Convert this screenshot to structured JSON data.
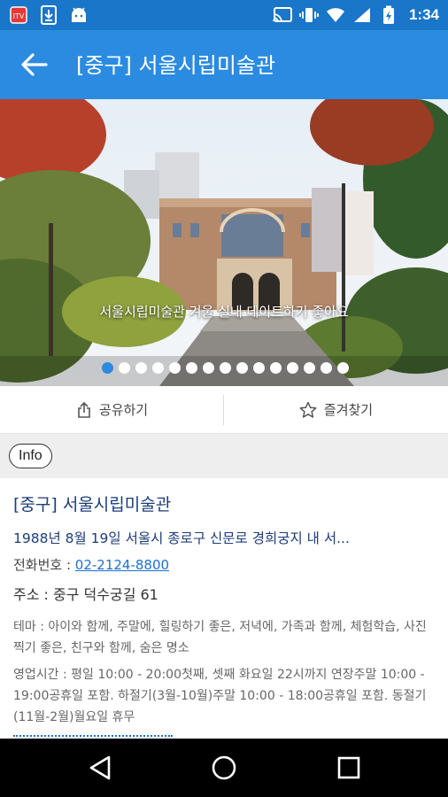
{
  "status": {
    "time": "1:34"
  },
  "appbar": {
    "title": "[중구] 서울시립미술관"
  },
  "hero": {
    "caption": "서울시립미술관 겨울 실내 데이트하기 좋아요",
    "total_slides": 15,
    "active_slide": 1
  },
  "actions": {
    "share_label": "공유하기",
    "favorite_label": "즐겨찾기"
  },
  "info": {
    "chip": "Info",
    "name": "[중구] 서울시립미술관",
    "summary": "1988년 8월 19일 서울시 종로구 신문로 경희궁지 내 서...",
    "phone_label": "전화번호 : ",
    "phone": "02-2124-8800",
    "address": "주소 : 중구 덕수궁길 61",
    "theme": "테마 : 아이와 함께, 주말에, 힐링하기 좋은, 저녁에, 가족과 함께, 체험학습, 사진찍기 좋은, 친구와 함께, 숨은 명소",
    "hours": "영업시간 : 평일 10:00 - 20:00첫째, 셋째 화요일 22시까지 연장주말 10:00 - 19:00공휴일 포함. 하절기(3월-10월)주말 10:00 - 18:00공휴일 포함. 동절기(11월-2월)월요일 휴무"
  },
  "colors": {
    "status_bar": "#1976c8",
    "app_bar": "#2b8be0",
    "title_text": "#1c3d78",
    "link": "#1c6fd1"
  }
}
